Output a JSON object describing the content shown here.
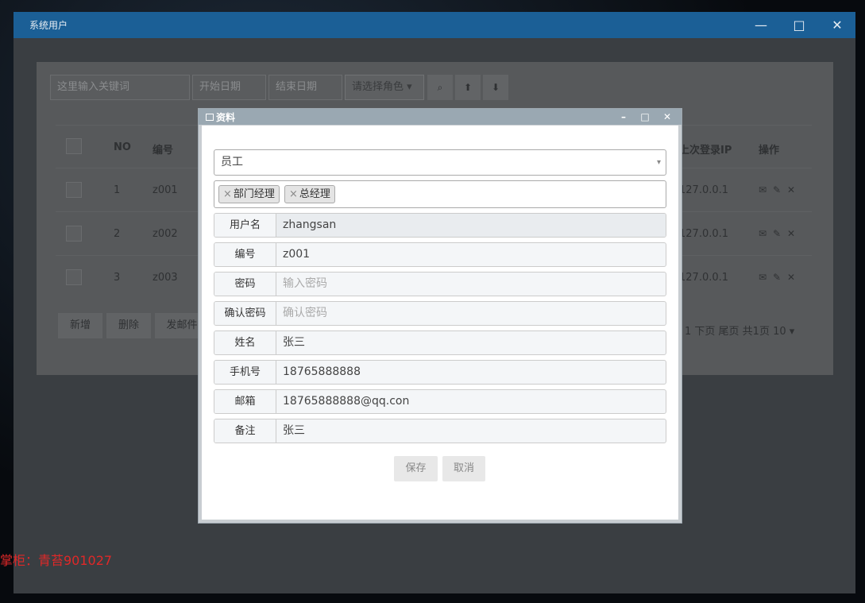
{
  "app": {
    "window_title": "系统用户",
    "minimize": "—",
    "maximize": "□",
    "close": "✕"
  },
  "toolbar": {
    "keyword_placeholder": "这里输入关键词",
    "start_date_placeholder": "开始日期",
    "end_date_placeholder": "结束日期",
    "role_select": "请选择角色",
    "role_caret": "▾",
    "search_glyph": "⌕",
    "upload_glyph": "⬆",
    "download_glyph": "⬇"
  },
  "table": {
    "headers": {
      "no": "NO",
      "code": "编号",
      "last_ip": "上次登录IP",
      "actions": "操作"
    },
    "rows": [
      {
        "no": "1",
        "code": "z001",
        "ip": "127.0.0.1"
      },
      {
        "no": "2",
        "code": "z002",
        "ip": "127.0.0.1"
      },
      {
        "no": "3",
        "code": "z003",
        "ip": "127.0.0.1"
      }
    ],
    "action_glyphs": [
      "✉",
      "✎",
      "✕"
    ]
  },
  "actions": {
    "add": "新增",
    "delete": "删除",
    "send_mail": "发邮件"
  },
  "pager": {
    "text": "1 下页  尾页  共1页  10 ▾"
  },
  "watermark": "掌柜：青苔901027",
  "dialog": {
    "title": "资料",
    "min": "–",
    "max": "□",
    "close": "✕",
    "select_value": "员工",
    "select_caret": "▾",
    "tags": [
      "部门经理",
      "总经理"
    ],
    "tag_x": "×",
    "fields": {
      "username": {
        "label": "用户名",
        "value": "zhangsan"
      },
      "code": {
        "label": "编号",
        "value": "z001"
      },
      "password": {
        "label": "密码",
        "placeholder": "输入密码"
      },
      "confirm": {
        "label": "确认密码",
        "placeholder": "确认密码"
      },
      "name": {
        "label": "姓名",
        "value": "张三"
      },
      "phone": {
        "label": "手机号",
        "value": "18765888888"
      },
      "email": {
        "label": "邮箱",
        "value": "18765888888@qq.con"
      },
      "note": {
        "label": "备注",
        "value": "张三"
      }
    },
    "save_label": "保存",
    "cancel_label": "取消"
  },
  "colors": {
    "titlebar": "#1b5f96",
    "dialog_title": "#9aa8b2",
    "watermark": "#e02828"
  }
}
